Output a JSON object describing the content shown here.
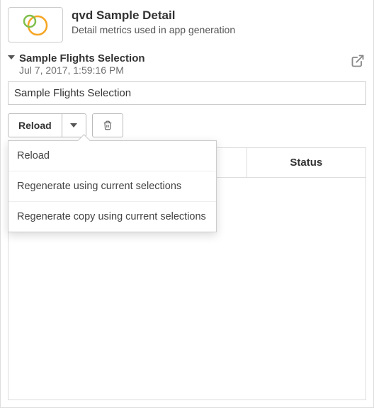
{
  "header": {
    "title": "qvd Sample Detail",
    "subtitle": "Detail metrics used in app generation"
  },
  "selection": {
    "title": "Sample Flights Selection",
    "date": "Jul 7, 2017, 1:59:16 PM"
  },
  "name_input": {
    "value": "Sample Flights Selection"
  },
  "toolbar": {
    "reload_label": "Reload"
  },
  "dropdown": {
    "items": [
      {
        "label": "Reload"
      },
      {
        "label": "Regenerate using current selections"
      },
      {
        "label": "Regenerate copy using current selections"
      }
    ]
  },
  "table": {
    "columns": [
      "",
      "",
      "Status"
    ]
  }
}
